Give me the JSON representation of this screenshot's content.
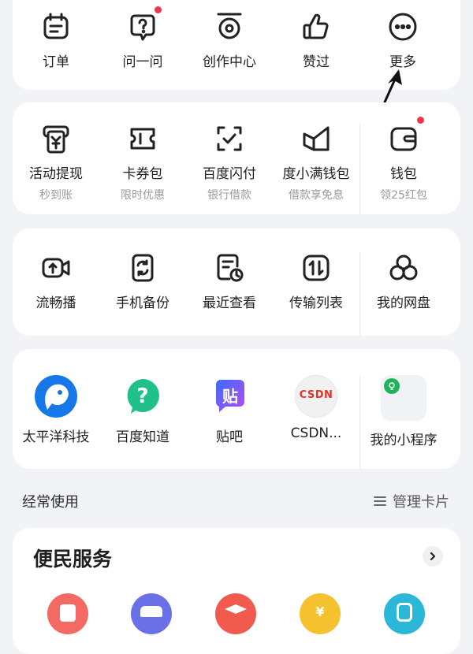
{
  "row1": [
    {
      "label": "订单",
      "icon": "order-icon"
    },
    {
      "label": "问一问",
      "icon": "question-icon",
      "badge": true
    },
    {
      "label": "创作中心",
      "icon": "creation-center-icon"
    },
    {
      "label": "赞过",
      "icon": "thumbs-up-icon"
    },
    {
      "label": "更多",
      "icon": "more-icon"
    }
  ],
  "row2": [
    {
      "label": "活动提现",
      "sub": "秒到账",
      "icon": "withdraw-icon"
    },
    {
      "label": "卡券包",
      "sub": "限时优惠",
      "icon": "coupon-icon"
    },
    {
      "label": "百度闪付",
      "sub": "银行借款",
      "icon": "flash-pay-icon"
    },
    {
      "label": "度小满钱包",
      "sub": "借款享免息",
      "icon": "duxiaoman-wallet-icon"
    },
    {
      "label": "钱包",
      "sub": "领25红包",
      "icon": "wallet-icon",
      "badge": true
    }
  ],
  "row3": [
    {
      "label": "流畅播",
      "icon": "smooth-play-icon"
    },
    {
      "label": "手机备份",
      "icon": "phone-backup-icon"
    },
    {
      "label": "最近查看",
      "icon": "recent-view-icon"
    },
    {
      "label": "传输列表",
      "icon": "transfer-list-icon"
    },
    {
      "label": "我的网盘",
      "icon": "netdisk-icon"
    }
  ],
  "row4": [
    {
      "label": "太平洋科技",
      "icon": "pconline-app-icon"
    },
    {
      "label": "百度知道",
      "icon": "baidu-zhidao-app-icon"
    },
    {
      "label": "贴吧",
      "icon": "tieba-app-icon",
      "glyph": "贴"
    },
    {
      "label": "CSDN...",
      "icon": "csdn-app-icon",
      "glyph": "CSDN"
    },
    {
      "label": "我的小程序",
      "icon": "mini-program-icon"
    }
  ],
  "frequent": {
    "title": "经常使用",
    "manage": "管理卡片"
  },
  "services": {
    "title": "便民服务"
  },
  "colors": {
    "accent_red": "#f0364b",
    "text": "#1f1f1f",
    "sub": "#9a9a9a",
    "bg": "#f2f3f7"
  }
}
